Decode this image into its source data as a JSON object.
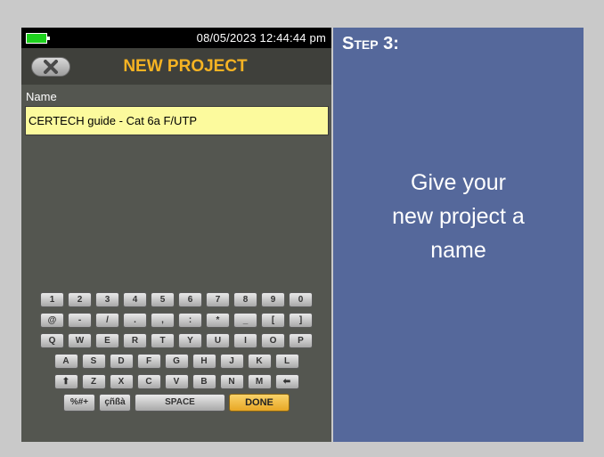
{
  "device": {
    "datetime": "08/05/2023 12:44:44 pm",
    "title": "NEW PROJECT",
    "name_label": "Name",
    "name_value": "CERTECH guide - Cat 6a F/UTP",
    "battery_color": "#1ed11e",
    "title_color": "#f6b323"
  },
  "keyboard": {
    "row1": [
      "1",
      "2",
      "3",
      "4",
      "5",
      "6",
      "7",
      "8",
      "9",
      "0"
    ],
    "row2": [
      "@",
      "-",
      "/",
      ".",
      ",",
      ":",
      "*",
      "_",
      "[",
      "]"
    ],
    "row3": [
      "Q",
      "W",
      "E",
      "R",
      "T",
      "Y",
      "U",
      "I",
      "O",
      "P"
    ],
    "row4": [
      "A",
      "S",
      "D",
      "F",
      "G",
      "H",
      "J",
      "K",
      "L"
    ],
    "row5": [
      "⬆",
      "Z",
      "X",
      "C",
      "V",
      "B",
      "N",
      "M",
      "⬅"
    ],
    "symbols_label": "%#+",
    "accents_label": "çñßà",
    "space_label": "SPACE",
    "done_label": "DONE"
  },
  "step": {
    "title": "Step 3:",
    "lines": [
      "Give your",
      "new project a",
      "name"
    ],
    "panel_color": "#55689b"
  }
}
